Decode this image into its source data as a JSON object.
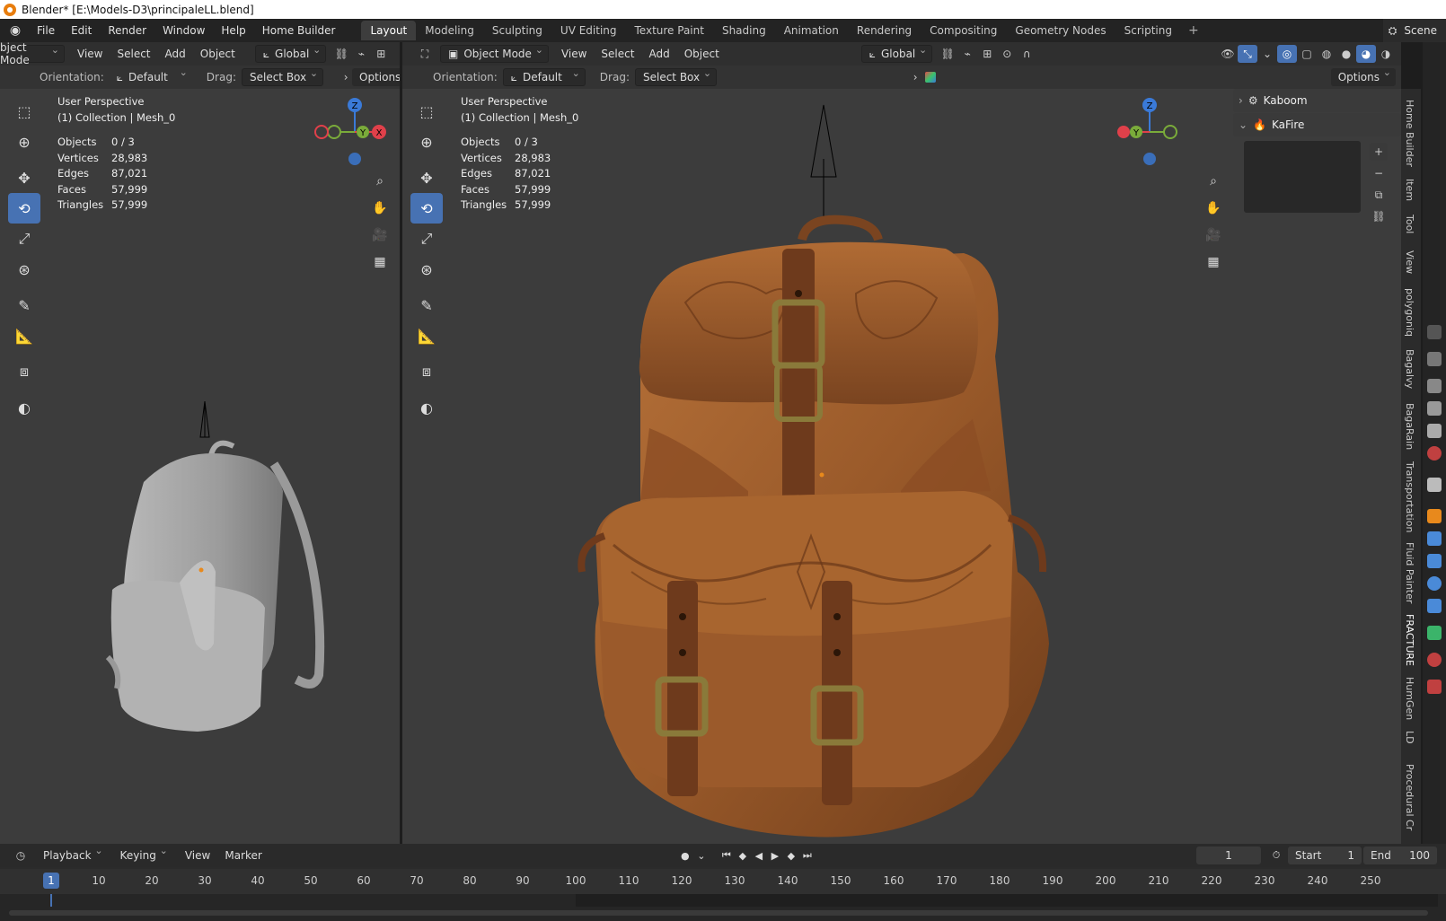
{
  "window": {
    "title": "Blender* [E:\\Models-D3\\principaleLL.blend]"
  },
  "menu": [
    "File",
    "Edit",
    "Render",
    "Window",
    "Help",
    "Home Builder"
  ],
  "workspaces": [
    "Layout",
    "Modeling",
    "Sculpting",
    "UV Editing",
    "Texture Paint",
    "Shading",
    "Animation",
    "Rendering",
    "Compositing",
    "Geometry Nodes",
    "Scripting"
  ],
  "active_workspace": "Layout",
  "scene": "Scene",
  "left_view": {
    "mode": "bject Mode",
    "menus": [
      "View",
      "Select",
      "Add",
      "Object"
    ],
    "orientation_dd": "Global",
    "orientation_label": "Orientation:",
    "orientation_value": "Default",
    "drag_label": "Drag:",
    "drag_value": "Select Box",
    "options": "Options",
    "perspective": "User Perspective",
    "collection": "(1) Collection | Mesh_0",
    "stats": [
      {
        "k": "Objects",
        "v": "0 / 3"
      },
      {
        "k": "Vertices",
        "v": "28,983"
      },
      {
        "k": "Edges",
        "v": "87,021"
      },
      {
        "k": "Faces",
        "v": "57,999"
      },
      {
        "k": "Triangles",
        "v": "57,999"
      }
    ]
  },
  "right_view": {
    "mode": "Object Mode",
    "menus": [
      "View",
      "Select",
      "Add",
      "Object"
    ],
    "orientation_dd": "Global",
    "orientation_label": "Orientation:",
    "orientation_value": "Default",
    "drag_label": "Drag:",
    "drag_value": "Select Box",
    "options": "Options",
    "perspective": "User Perspective",
    "collection": "(1) Collection | Mesh_0",
    "stats": [
      {
        "k": "Objects",
        "v": "0 / 3"
      },
      {
        "k": "Vertices",
        "v": "28,983"
      },
      {
        "k": "Edges",
        "v": "87,021"
      },
      {
        "k": "Faces",
        "v": "57,999"
      },
      {
        "k": "Triangles",
        "v": "57,999"
      }
    ]
  },
  "gizmo": {
    "z": "Z",
    "y": "Y",
    "x": "X"
  },
  "npanel": {
    "items": [
      "Kaboom",
      "KaFire"
    ]
  },
  "sidebar_tabs": [
    "Home Builder",
    "Item",
    "Tool",
    "View",
    "polygoniq",
    "Bagalvy",
    "BagaRain",
    "Transportation",
    "Fluid Painter",
    "FRACTURE",
    "HumGen",
    "LD",
    "Procedural Cr"
  ],
  "timeline": {
    "menus": [
      "Playback",
      "Keying",
      "View",
      "Marker"
    ],
    "current_frame": "1",
    "start_label": "Start",
    "start": "1",
    "end_label": "End",
    "end": "100",
    "ticks": [
      "10",
      "20",
      "30",
      "40",
      "50",
      "60",
      "70",
      "80",
      "90",
      "100",
      "110",
      "120",
      "130",
      "140",
      "150",
      "160",
      "170",
      "180",
      "190",
      "200",
      "210",
      "220",
      "230",
      "240",
      "250"
    ],
    "marker": "1"
  },
  "colors": {
    "accent": "#4772b3",
    "axis_x": "#e0404a",
    "axis_y": "#7aab3a",
    "axis_z": "#3a7ad8",
    "leather": "#a5622f"
  }
}
